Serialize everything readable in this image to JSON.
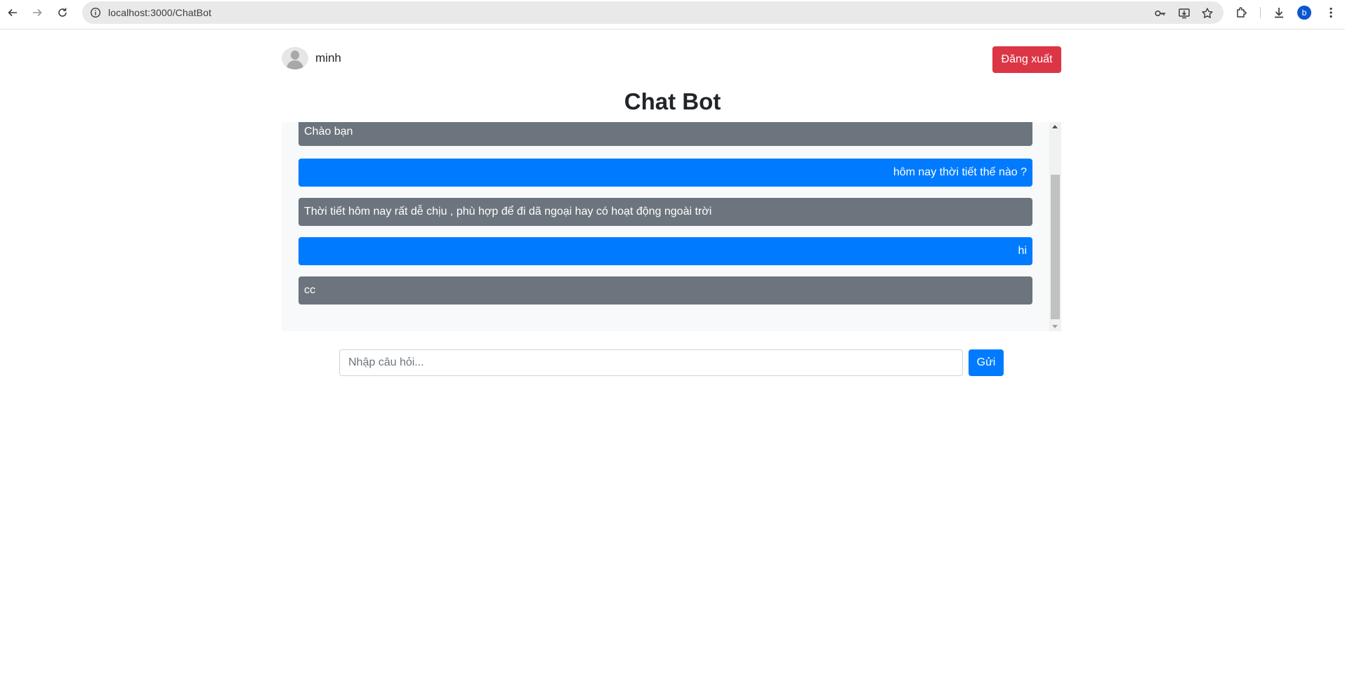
{
  "browser": {
    "url": "localhost:3000/ChatBot",
    "profile_initial": "b"
  },
  "header": {
    "username": "minh",
    "logout_label": "Đăng xuất"
  },
  "page": {
    "title": "Chat Bot"
  },
  "chat": {
    "messages": [
      {
        "sender": "bot",
        "text": "Chào bạn"
      },
      {
        "sender": "user",
        "text": "hôm nay thời tiết thế nào ?"
      },
      {
        "sender": "bot",
        "text": "Thời tiết hôm nay rất dễ chịu , phù hợp để đi dã ngoại hay có hoạt động ngoài trời"
      },
      {
        "sender": "user",
        "text": "hi"
      },
      {
        "sender": "bot",
        "text": "cc"
      }
    ]
  },
  "composer": {
    "placeholder": "Nhập câu hỏi...",
    "value": "",
    "send_label": "Gửi"
  },
  "colors": {
    "bot_bubble": "#6c757d",
    "user_bubble": "#007bff",
    "logout": "#dc3545",
    "send": "#007bff"
  }
}
